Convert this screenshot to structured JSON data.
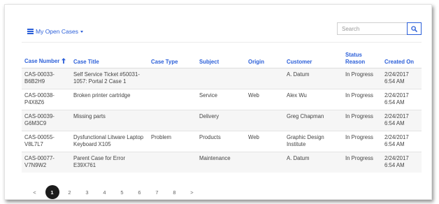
{
  "view_selector": {
    "label": "My Open Cases"
  },
  "search": {
    "placeholder": "Search"
  },
  "table": {
    "columns": [
      {
        "label": "Case Number"
      },
      {
        "label": "Case Title"
      },
      {
        "label": "Case Type"
      },
      {
        "label": "Subject"
      },
      {
        "label": "Origin"
      },
      {
        "label": "Customer"
      },
      {
        "label": "Status Reason"
      },
      {
        "label": "Created On"
      }
    ],
    "rows": [
      {
        "case_number": "CAS-00033-B6B2H9",
        "case_title": "Self Service Ticket #50031-1057: Portal 2 Case 1",
        "case_type": "",
        "subject": "",
        "origin": "",
        "customer": "A. Datum",
        "status": "In Progress",
        "created_on": "2/24/2017 6:54 AM"
      },
      {
        "case_number": "CAS-00038-P4X8Z6",
        "case_title": "Broken printer cartridge",
        "case_type": "",
        "subject": "Service",
        "origin": "Web",
        "customer": "Alex Wu",
        "status": "In Progress",
        "created_on": "2/24/2017 6:54 AM"
      },
      {
        "case_number": "CAS-00039-G6M3C9",
        "case_title": "Missing parts",
        "case_type": "",
        "subject": "Delivery",
        "origin": "",
        "customer": "Greg Chapman",
        "status": "In Progress",
        "created_on": "2/24/2017 6:54 AM"
      },
      {
        "case_number": "CAS-00055-V8L7L7",
        "case_title": "Dysfunctional Litware Laptop Keyboard X105",
        "case_type": "Problem",
        "subject": "Products",
        "origin": "Web",
        "customer": "Graphic Design Institute",
        "status": "In Progress",
        "created_on": "2/24/2017 6:54 AM"
      },
      {
        "case_number": "CAS-00077-V7N9W2",
        "case_title": "Parent Case for Error E39X761",
        "case_type": "",
        "subject": "Maintenance",
        "origin": "",
        "customer": "A. Datum",
        "status": "In Progress",
        "created_on": "2/24/2017 6:54 AM"
      }
    ]
  },
  "pagination": {
    "prev": "<",
    "next": ">",
    "pages": [
      "1",
      "2",
      "3",
      "4",
      "5",
      "6",
      "7",
      "8"
    ],
    "current": "1"
  },
  "colors": {
    "accent": "#2b5fd9",
    "active_page": "#1c1c1c",
    "row_stripe": "#f6f6f6"
  },
  "icons": {
    "view": "list-icon",
    "search": "search-icon",
    "sort": "sort-up-arrow-icon"
  }
}
